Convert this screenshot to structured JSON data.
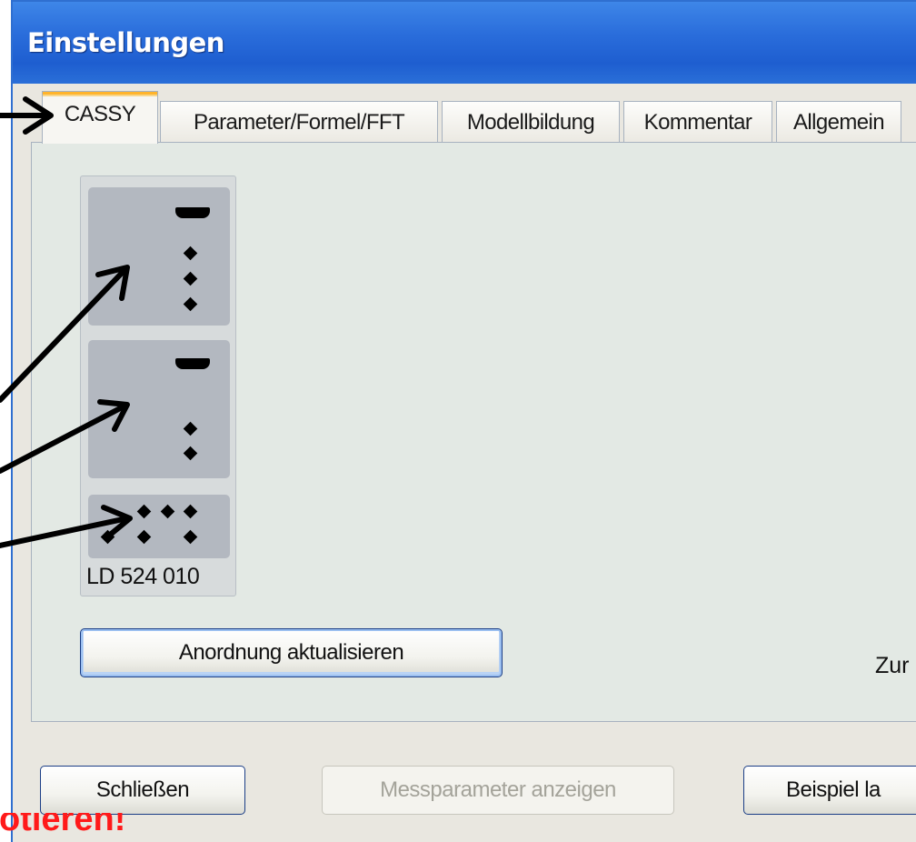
{
  "window": {
    "title": "Einstellungen"
  },
  "tabs": [
    {
      "label": "CASSY",
      "active": true
    },
    {
      "label": "Parameter/Formel/FFT",
      "active": false
    },
    {
      "label": "Modellbildung",
      "active": false
    },
    {
      "label": "Kommentar",
      "active": false
    },
    {
      "label": "Allgemein",
      "active": false
    }
  ],
  "cassy_module": {
    "label": "LD  524 010"
  },
  "buttons": {
    "update_arrangement": "Anordnung aktualisieren",
    "close": "Schließen",
    "show_parameters": "Messparameter anzeigen",
    "load_example": "Beispiel la"
  },
  "partial_label": "Zur",
  "overlay_text": "otieren!",
  "colors": {
    "titlebar": "#2a6ddb",
    "tab_highlight": "#ffb42c",
    "panel": "#e3e9e4",
    "overlay_red": "#ff1a1a"
  }
}
